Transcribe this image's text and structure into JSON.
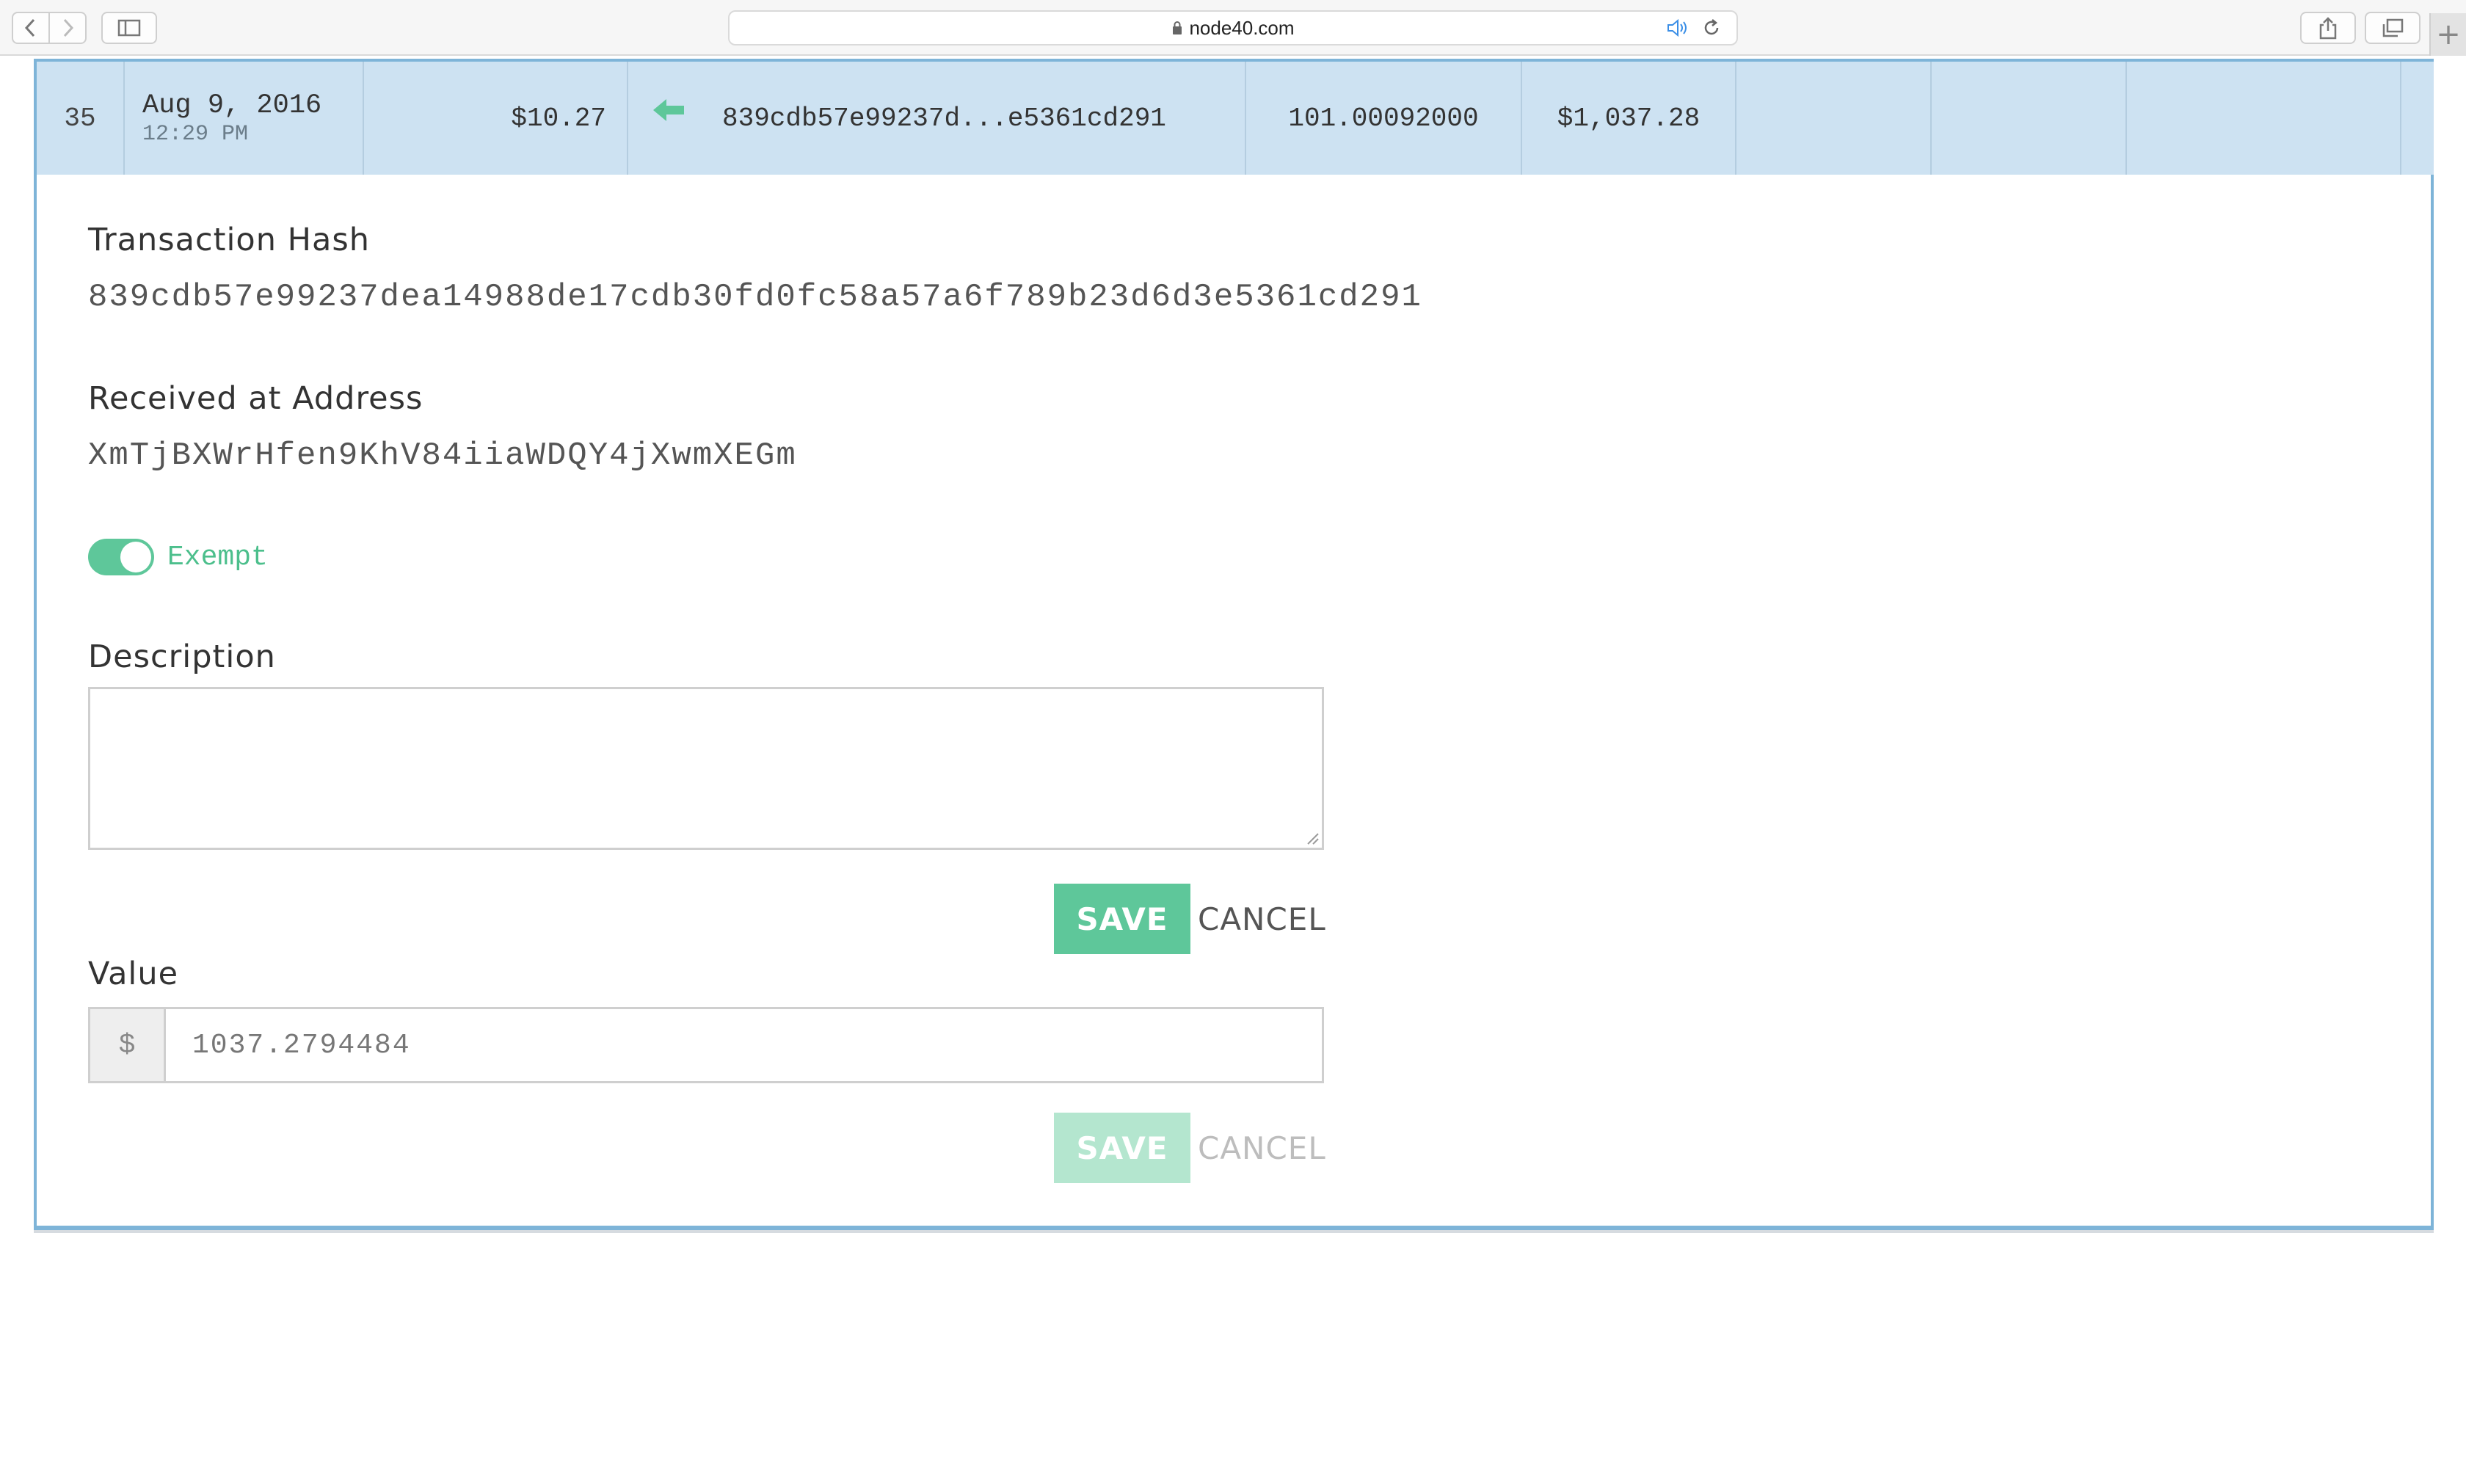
{
  "browser": {
    "url": "node40.com"
  },
  "transaction_row": {
    "index": "35",
    "date": "Aug 9, 2016",
    "time": "12:29 PM",
    "price": "$10.27",
    "direction_icon": "arrow-left-icon",
    "hash_short": "839cdb57e99237d...e5361cd291",
    "amount": "101.00092000",
    "fiat_value": "$1,037.28"
  },
  "detail": {
    "hash_label": "Transaction Hash",
    "hash_full": "839cdb57e99237dea14988de17cdb30fd0fc58a57a6f789b23d6d3e5361cd291",
    "address_label": "Received at Address",
    "address": "XmTjBXWrHfen9KhV84iiaWDQY4jXwmXEGm",
    "exempt_label": "Exempt",
    "exempt_on": true,
    "description_label": "Description",
    "description_value": "",
    "save_label": "SAVE",
    "cancel_label": "CANCEL",
    "value_label": "Value",
    "currency_symbol": "$",
    "value_input": "1037.2794484",
    "value_save_label": "SAVE",
    "value_cancel_label": "CANCEL"
  },
  "colors": {
    "accent_green": "#5ec79a",
    "row_highlight": "#cde2f2",
    "panel_border": "#7eb4d8"
  }
}
